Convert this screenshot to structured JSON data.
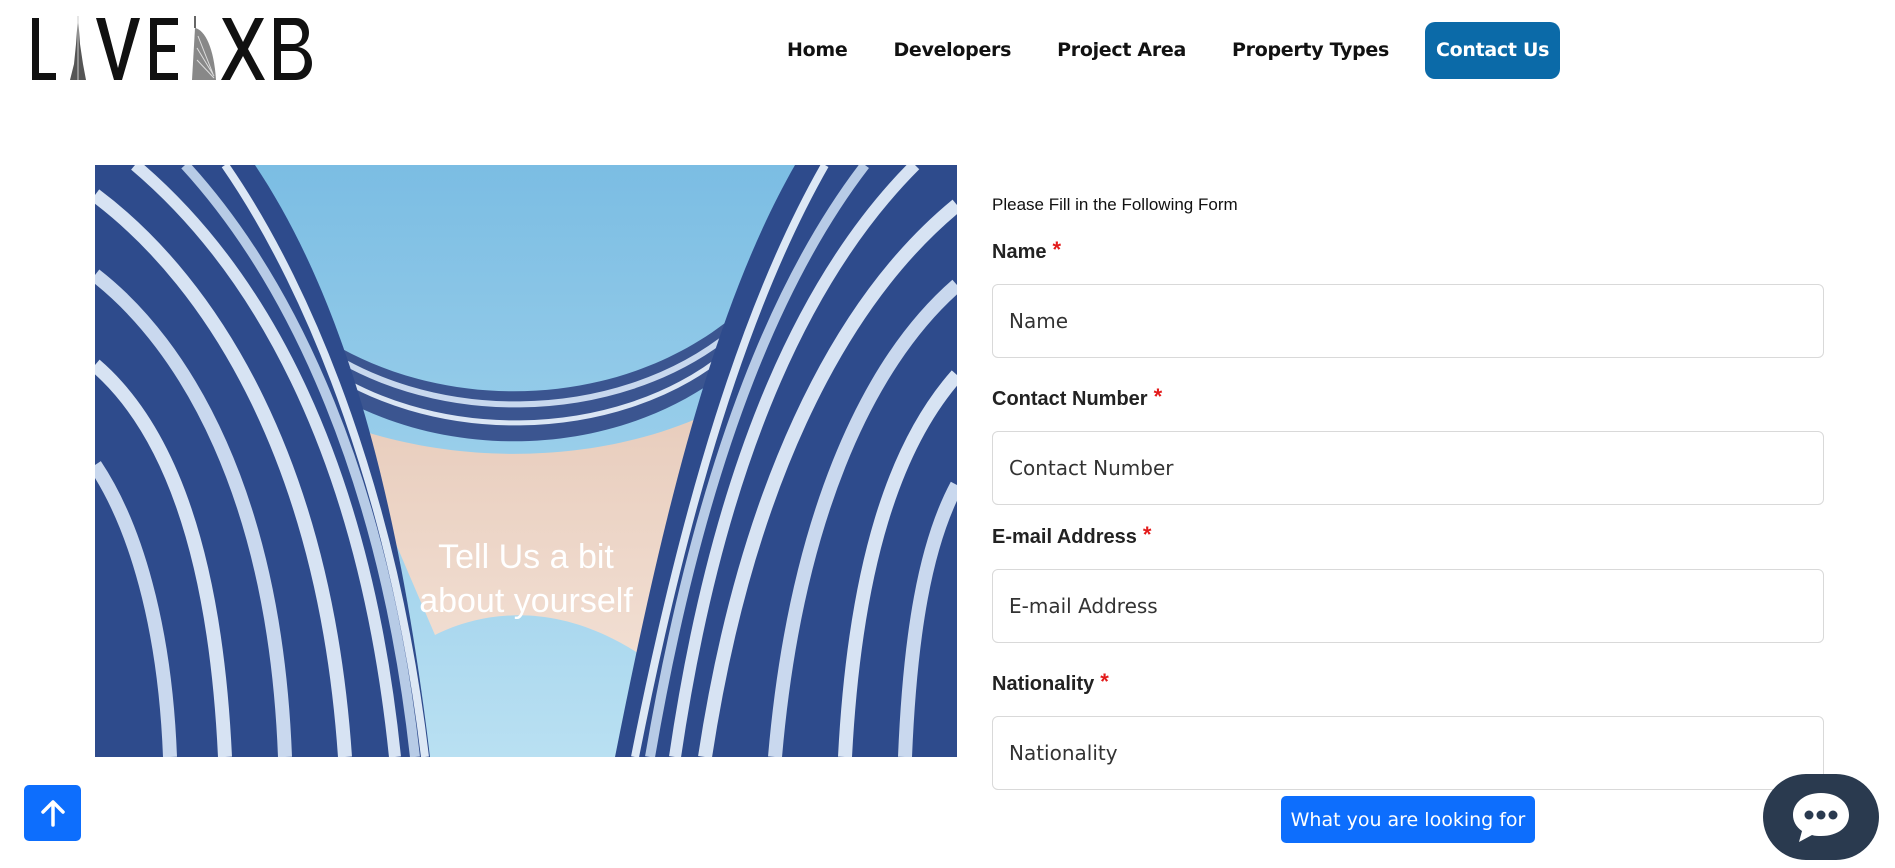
{
  "brand": {
    "logo_text": "LIVEDXB"
  },
  "nav": {
    "items": [
      {
        "label": "Home"
      },
      {
        "label": "Developers"
      },
      {
        "label": "Project Area"
      },
      {
        "label": "Property Types"
      }
    ],
    "contact_label": "Contact Us"
  },
  "hero": {
    "line1": "Tell Us a bit",
    "line2": "about yourself"
  },
  "form": {
    "intro": "Please Fill in the Following Form",
    "required_mark": "*",
    "fields": [
      {
        "label": "Name",
        "placeholder": "Name"
      },
      {
        "label": "Contact Number",
        "placeholder": "Contact Number"
      },
      {
        "label": "E-mail Address",
        "placeholder": "E-mail Address"
      },
      {
        "label": "Nationality",
        "placeholder": "Nationality"
      }
    ],
    "looking_for_label": "What you are looking for"
  },
  "colors": {
    "primary": "#0d6efd",
    "nav_contact": "#0b6aa8",
    "required": "#e31b1b",
    "chat": "#2a3a4f"
  },
  "icons": {
    "scroll_top": "arrow-up-icon",
    "chat": "chat-bubble-icon"
  }
}
